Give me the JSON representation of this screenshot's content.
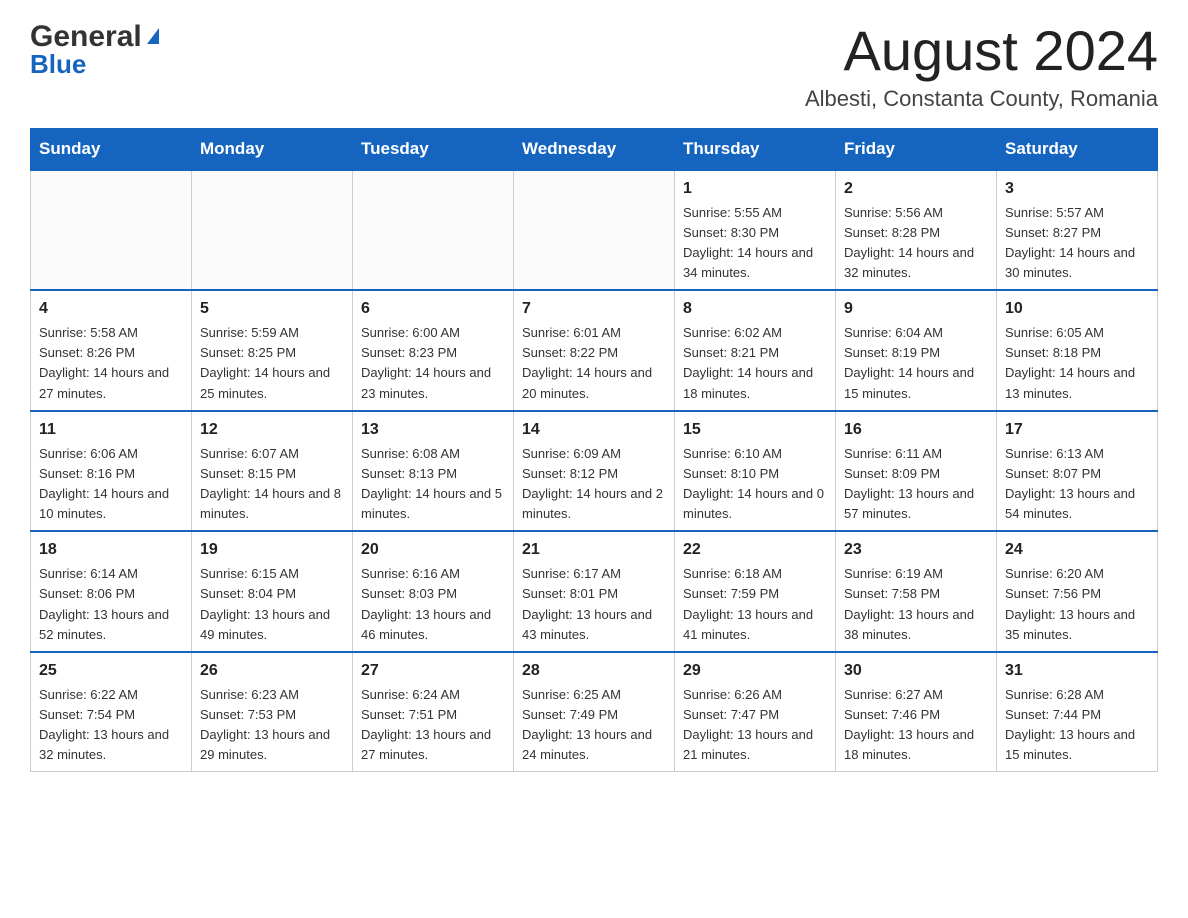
{
  "logo": {
    "general": "General",
    "blue": "Blue",
    "triangle": "▲"
  },
  "title": "August 2024",
  "subtitle": "Albesti, Constanta County, Romania",
  "days_of_week": [
    "Sunday",
    "Monday",
    "Tuesday",
    "Wednesday",
    "Thursday",
    "Friday",
    "Saturday"
  ],
  "weeks": [
    [
      {
        "day": "",
        "info": ""
      },
      {
        "day": "",
        "info": ""
      },
      {
        "day": "",
        "info": ""
      },
      {
        "day": "",
        "info": ""
      },
      {
        "day": "1",
        "info": "Sunrise: 5:55 AM\nSunset: 8:30 PM\nDaylight: 14 hours and 34 minutes."
      },
      {
        "day": "2",
        "info": "Sunrise: 5:56 AM\nSunset: 8:28 PM\nDaylight: 14 hours and 32 minutes."
      },
      {
        "day": "3",
        "info": "Sunrise: 5:57 AM\nSunset: 8:27 PM\nDaylight: 14 hours and 30 minutes."
      }
    ],
    [
      {
        "day": "4",
        "info": "Sunrise: 5:58 AM\nSunset: 8:26 PM\nDaylight: 14 hours and 27 minutes."
      },
      {
        "day": "5",
        "info": "Sunrise: 5:59 AM\nSunset: 8:25 PM\nDaylight: 14 hours and 25 minutes."
      },
      {
        "day": "6",
        "info": "Sunrise: 6:00 AM\nSunset: 8:23 PM\nDaylight: 14 hours and 23 minutes."
      },
      {
        "day": "7",
        "info": "Sunrise: 6:01 AM\nSunset: 8:22 PM\nDaylight: 14 hours and 20 minutes."
      },
      {
        "day": "8",
        "info": "Sunrise: 6:02 AM\nSunset: 8:21 PM\nDaylight: 14 hours and 18 minutes."
      },
      {
        "day": "9",
        "info": "Sunrise: 6:04 AM\nSunset: 8:19 PM\nDaylight: 14 hours and 15 minutes."
      },
      {
        "day": "10",
        "info": "Sunrise: 6:05 AM\nSunset: 8:18 PM\nDaylight: 14 hours and 13 minutes."
      }
    ],
    [
      {
        "day": "11",
        "info": "Sunrise: 6:06 AM\nSunset: 8:16 PM\nDaylight: 14 hours and 10 minutes."
      },
      {
        "day": "12",
        "info": "Sunrise: 6:07 AM\nSunset: 8:15 PM\nDaylight: 14 hours and 8 minutes."
      },
      {
        "day": "13",
        "info": "Sunrise: 6:08 AM\nSunset: 8:13 PM\nDaylight: 14 hours and 5 minutes."
      },
      {
        "day": "14",
        "info": "Sunrise: 6:09 AM\nSunset: 8:12 PM\nDaylight: 14 hours and 2 minutes."
      },
      {
        "day": "15",
        "info": "Sunrise: 6:10 AM\nSunset: 8:10 PM\nDaylight: 14 hours and 0 minutes."
      },
      {
        "day": "16",
        "info": "Sunrise: 6:11 AM\nSunset: 8:09 PM\nDaylight: 13 hours and 57 minutes."
      },
      {
        "day": "17",
        "info": "Sunrise: 6:13 AM\nSunset: 8:07 PM\nDaylight: 13 hours and 54 minutes."
      }
    ],
    [
      {
        "day": "18",
        "info": "Sunrise: 6:14 AM\nSunset: 8:06 PM\nDaylight: 13 hours and 52 minutes."
      },
      {
        "day": "19",
        "info": "Sunrise: 6:15 AM\nSunset: 8:04 PM\nDaylight: 13 hours and 49 minutes."
      },
      {
        "day": "20",
        "info": "Sunrise: 6:16 AM\nSunset: 8:03 PM\nDaylight: 13 hours and 46 minutes."
      },
      {
        "day": "21",
        "info": "Sunrise: 6:17 AM\nSunset: 8:01 PM\nDaylight: 13 hours and 43 minutes."
      },
      {
        "day": "22",
        "info": "Sunrise: 6:18 AM\nSunset: 7:59 PM\nDaylight: 13 hours and 41 minutes."
      },
      {
        "day": "23",
        "info": "Sunrise: 6:19 AM\nSunset: 7:58 PM\nDaylight: 13 hours and 38 minutes."
      },
      {
        "day": "24",
        "info": "Sunrise: 6:20 AM\nSunset: 7:56 PM\nDaylight: 13 hours and 35 minutes."
      }
    ],
    [
      {
        "day": "25",
        "info": "Sunrise: 6:22 AM\nSunset: 7:54 PM\nDaylight: 13 hours and 32 minutes."
      },
      {
        "day": "26",
        "info": "Sunrise: 6:23 AM\nSunset: 7:53 PM\nDaylight: 13 hours and 29 minutes."
      },
      {
        "day": "27",
        "info": "Sunrise: 6:24 AM\nSunset: 7:51 PM\nDaylight: 13 hours and 27 minutes."
      },
      {
        "day": "28",
        "info": "Sunrise: 6:25 AM\nSunset: 7:49 PM\nDaylight: 13 hours and 24 minutes."
      },
      {
        "day": "29",
        "info": "Sunrise: 6:26 AM\nSunset: 7:47 PM\nDaylight: 13 hours and 21 minutes."
      },
      {
        "day": "30",
        "info": "Sunrise: 6:27 AM\nSunset: 7:46 PM\nDaylight: 13 hours and 18 minutes."
      },
      {
        "day": "31",
        "info": "Sunrise: 6:28 AM\nSunset: 7:44 PM\nDaylight: 13 hours and 15 minutes."
      }
    ]
  ]
}
